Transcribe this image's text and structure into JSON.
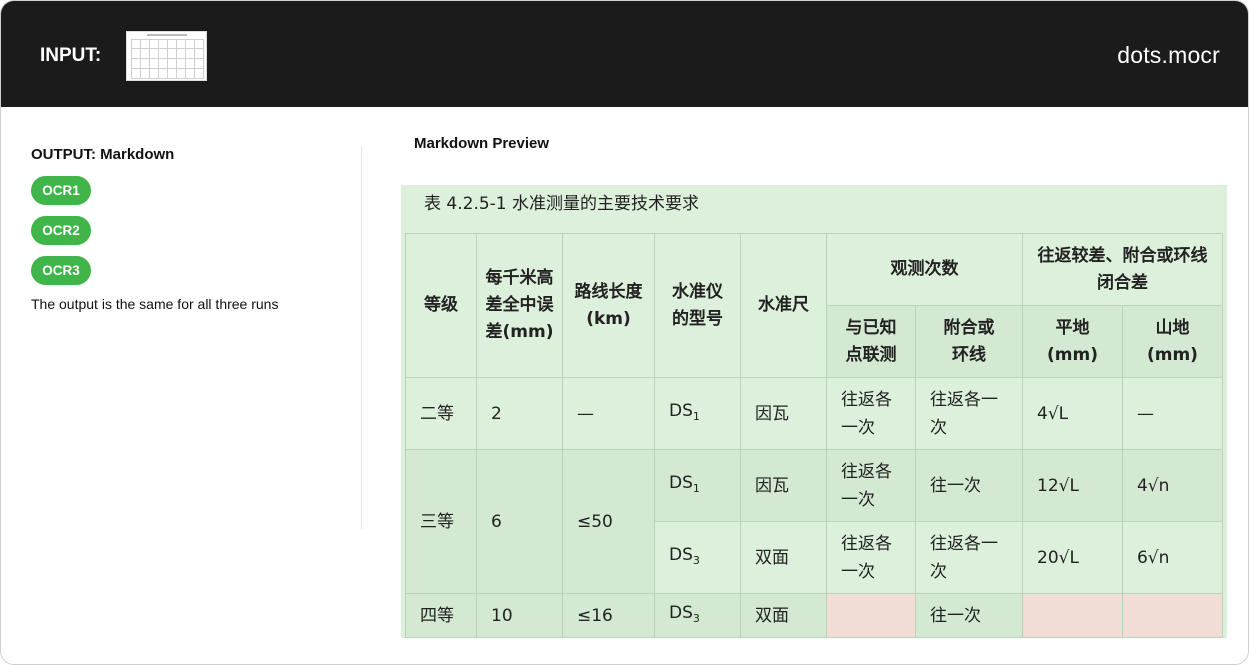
{
  "header": {
    "input_label": "INPUT:",
    "brand": "dots.mocr"
  },
  "left_panel": {
    "output_label": "OUTPUT: Markdown",
    "runs": [
      "OCR1",
      "OCR2",
      "OCR3"
    ],
    "note": "The output is the same for all three runs"
  },
  "preview": {
    "title": "Markdown Preview",
    "caption": "表 4.2.5-1 水准测量的主要技术要求",
    "headers": {
      "grade": "等级",
      "error": "每千米高差全中误差(mm)",
      "route": "路线长度(km)",
      "instrument": "水准仪的型号",
      "rod": "水准尺",
      "obs": "观测次数",
      "diff": "往返较差、附合或环线闭合差",
      "known": "与已知点联测",
      "closed": "附合或环线",
      "flat": "平地(mm)",
      "mountain": "山地(mm)"
    },
    "rows": [
      {
        "grade": "二等",
        "error": "2",
        "route": "—",
        "instrument_base": "DS",
        "instrument_sub": "1",
        "rod": "因瓦",
        "known": "往返各一次",
        "closed": "往返各一次",
        "flat": "4√L",
        "mountain": "—"
      },
      {
        "grade": "三等",
        "error": "6",
        "route": "≤50",
        "instrument_base": "DS",
        "instrument_sub": "1",
        "rod": "因瓦",
        "known": "往返各一次",
        "closed": "往一次",
        "flat": "12√L",
        "mountain": "4√n"
      },
      {
        "instrument_base": "DS",
        "instrument_sub": "3",
        "rod": "双面",
        "known": "往返各一次",
        "closed": "往返各一次",
        "flat": "20√L",
        "mountain": "6√n"
      },
      {
        "grade": "四等",
        "error": "10",
        "route": "≤16",
        "instrument_base": "DS",
        "instrument_sub": "3",
        "rod": "双面",
        "known": "",
        "closed": "往一次",
        "flat": "",
        "mountain": ""
      }
    ]
  },
  "colors": {
    "topbar": "#1b1b1b",
    "accent_green": "#3fb54a",
    "preview_bg": "#dcf0db",
    "missing_cell": "#f1dcd6"
  }
}
